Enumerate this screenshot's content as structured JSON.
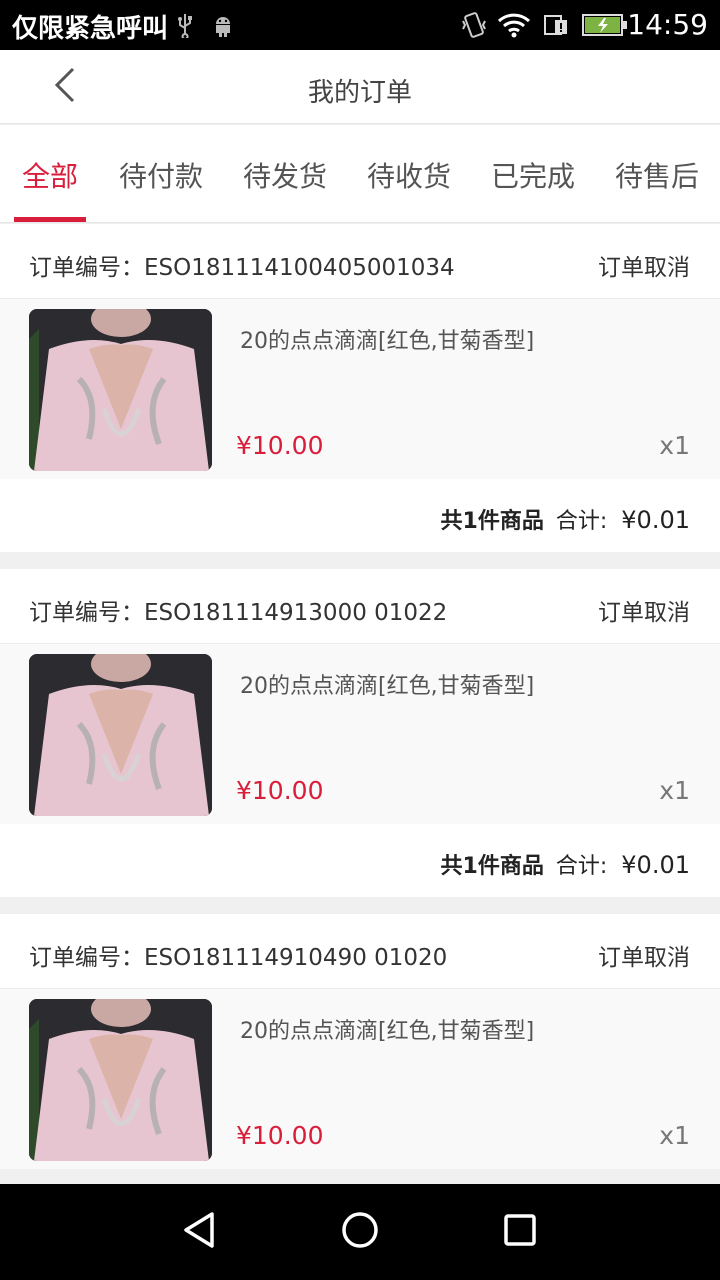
{
  "status_bar": {
    "carrier": "仅限紧急呼叫",
    "time": "14:59",
    "icons": [
      "usb-icon",
      "android-debug-icon",
      "vibrate-icon",
      "wifi-icon",
      "sim-icon",
      "battery-charging-icon"
    ]
  },
  "header": {
    "title": "我的订单"
  },
  "tabs": [
    {
      "label": "全部",
      "active": true
    },
    {
      "label": "待付款",
      "active": false
    },
    {
      "label": "待发货",
      "active": false
    },
    {
      "label": "待收货",
      "active": false
    },
    {
      "label": "已完成",
      "active": false
    },
    {
      "label": "待售后",
      "active": false
    }
  ],
  "orders": [
    {
      "order_no": "订单编号：ESO181114100405001034",
      "status": "订单取消",
      "item": {
        "name": "20的点点滴滴[红色,甘菊香型]",
        "price": "¥10.00",
        "qty": "x1"
      },
      "summary": {
        "count": "共1件商品",
        "total_label": "合计:",
        "total": "¥0.01"
      }
    },
    {
      "order_no": "订单编号：ESO181114913000 01022",
      "status": "订单取消",
      "item": {
        "name": "20的点点滴滴[红色,甘菊香型]",
        "price": "¥10.00",
        "qty": "x1"
      },
      "summary": {
        "count": "共1件商品",
        "total_label": "合计:",
        "total": "¥0.01"
      }
    },
    {
      "order_no": "订单编号：ESO181114910490 01020",
      "status": "订单取消",
      "item": {
        "name": "20的点点滴滴[红色,甘菊香型]",
        "price": "¥10.00",
        "qty": "x1"
      }
    }
  ],
  "colors": {
    "accent": "#d81e3a",
    "background": "#f0f0f0"
  }
}
